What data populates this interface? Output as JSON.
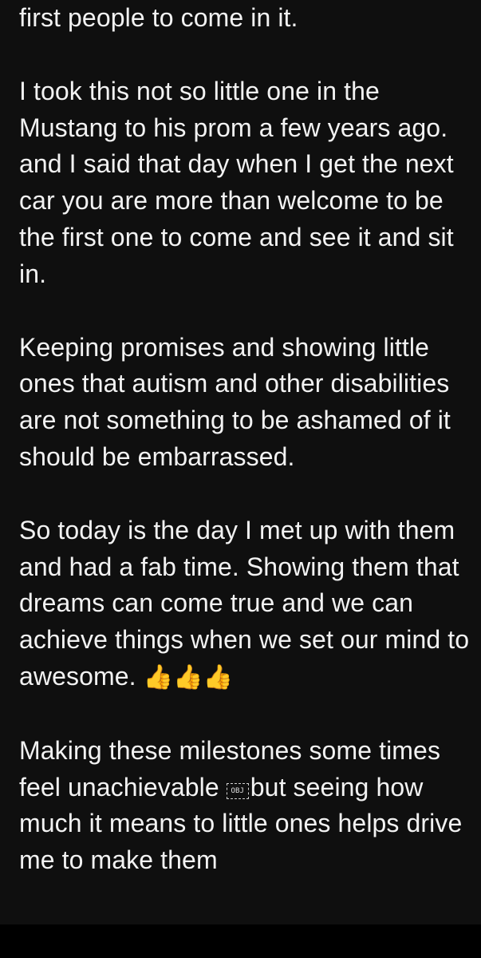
{
  "post": {
    "p0": "first people to come in it.",
    "p1": "I took this not so little one in the Mustang to his prom a few years ago. and I said that day when I get the next car you are more than welcome to be the first one to come and see it and sit in.",
    "p2": "Keeping promises and showing little ones that autism and other disabilities are not something to be ashamed of it should be embarrassed.",
    "p3": "So today is the day I met up with them and had a fab time. Showing them that dreams can come true and we can achieve things when we set our mind to awesome.",
    "p3_emoji": "👍👍👍",
    "p4_before": "Making these milestones some times feel unachievable",
    "p4_obj": "OBJ",
    "p4_after": "but seeing how much it means to little ones helps drive me to make them"
  },
  "colors": {
    "background": "#0f0f0f",
    "text": "#f2f2f2",
    "thumbs_up": "#f5b324"
  }
}
